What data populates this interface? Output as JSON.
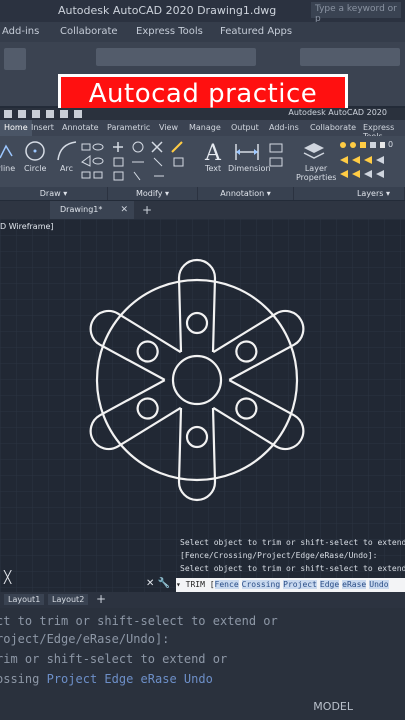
{
  "background_title": "Autodesk AutoCAD 2020  Drawing1.dwg",
  "background_search": "Type a keyword or p",
  "background_tabs": [
    "Add-ins",
    "Collaborate",
    "Express Tools",
    "Featured Apps"
  ],
  "banner": "Autocad practice",
  "app_title": "Autodesk AutoCAD 2020",
  "ribbon_tabs": [
    "Home",
    "Insert",
    "Annotate",
    "Parametric",
    "View",
    "Manage",
    "Output",
    "Add-ins",
    "Collaborate",
    "Express Tools"
  ],
  "ribbon_tools": {
    "polyline": "yline",
    "circle": "Circle",
    "arc": "Arc",
    "text": "Text",
    "dimension": "Dimension",
    "layer_properties": "Layer Properties"
  },
  "panels": {
    "draw": "Draw",
    "modify": "Modify",
    "annotation": "Annotation",
    "layers": "Layers"
  },
  "layer_value": "0",
  "document_tab": "Drawing1*",
  "viewport_label": "D Wireframe]",
  "command_history": [
    "Select object to trim or shift-select to extend o",
    "[Fence/Crossing/Project/Edge/eRase/Undo]:",
    "Select object to trim or shift-select to extend o"
  ],
  "command_prompt": "TRIM [",
  "command_options": [
    "Fence",
    "Crossing",
    "Project",
    "Edge",
    "eRase",
    "Undo"
  ],
  "layout_tabs": [
    "Layout1",
    "Layout2"
  ],
  "bottom_lines": [
    "ct to trim or shift-select to extend or",
    "roject/Edge/eRase/Undo]:",
    "rim or shift-select to extend or"
  ],
  "bottom_options": [
    "ossing",
    "Project",
    "Edge",
    "eRase",
    "Undo"
  ],
  "status_model": "MODEL",
  "colors": {
    "accent": "#ff1010",
    "canvas": "#212834",
    "ribbon": "#414a59"
  }
}
